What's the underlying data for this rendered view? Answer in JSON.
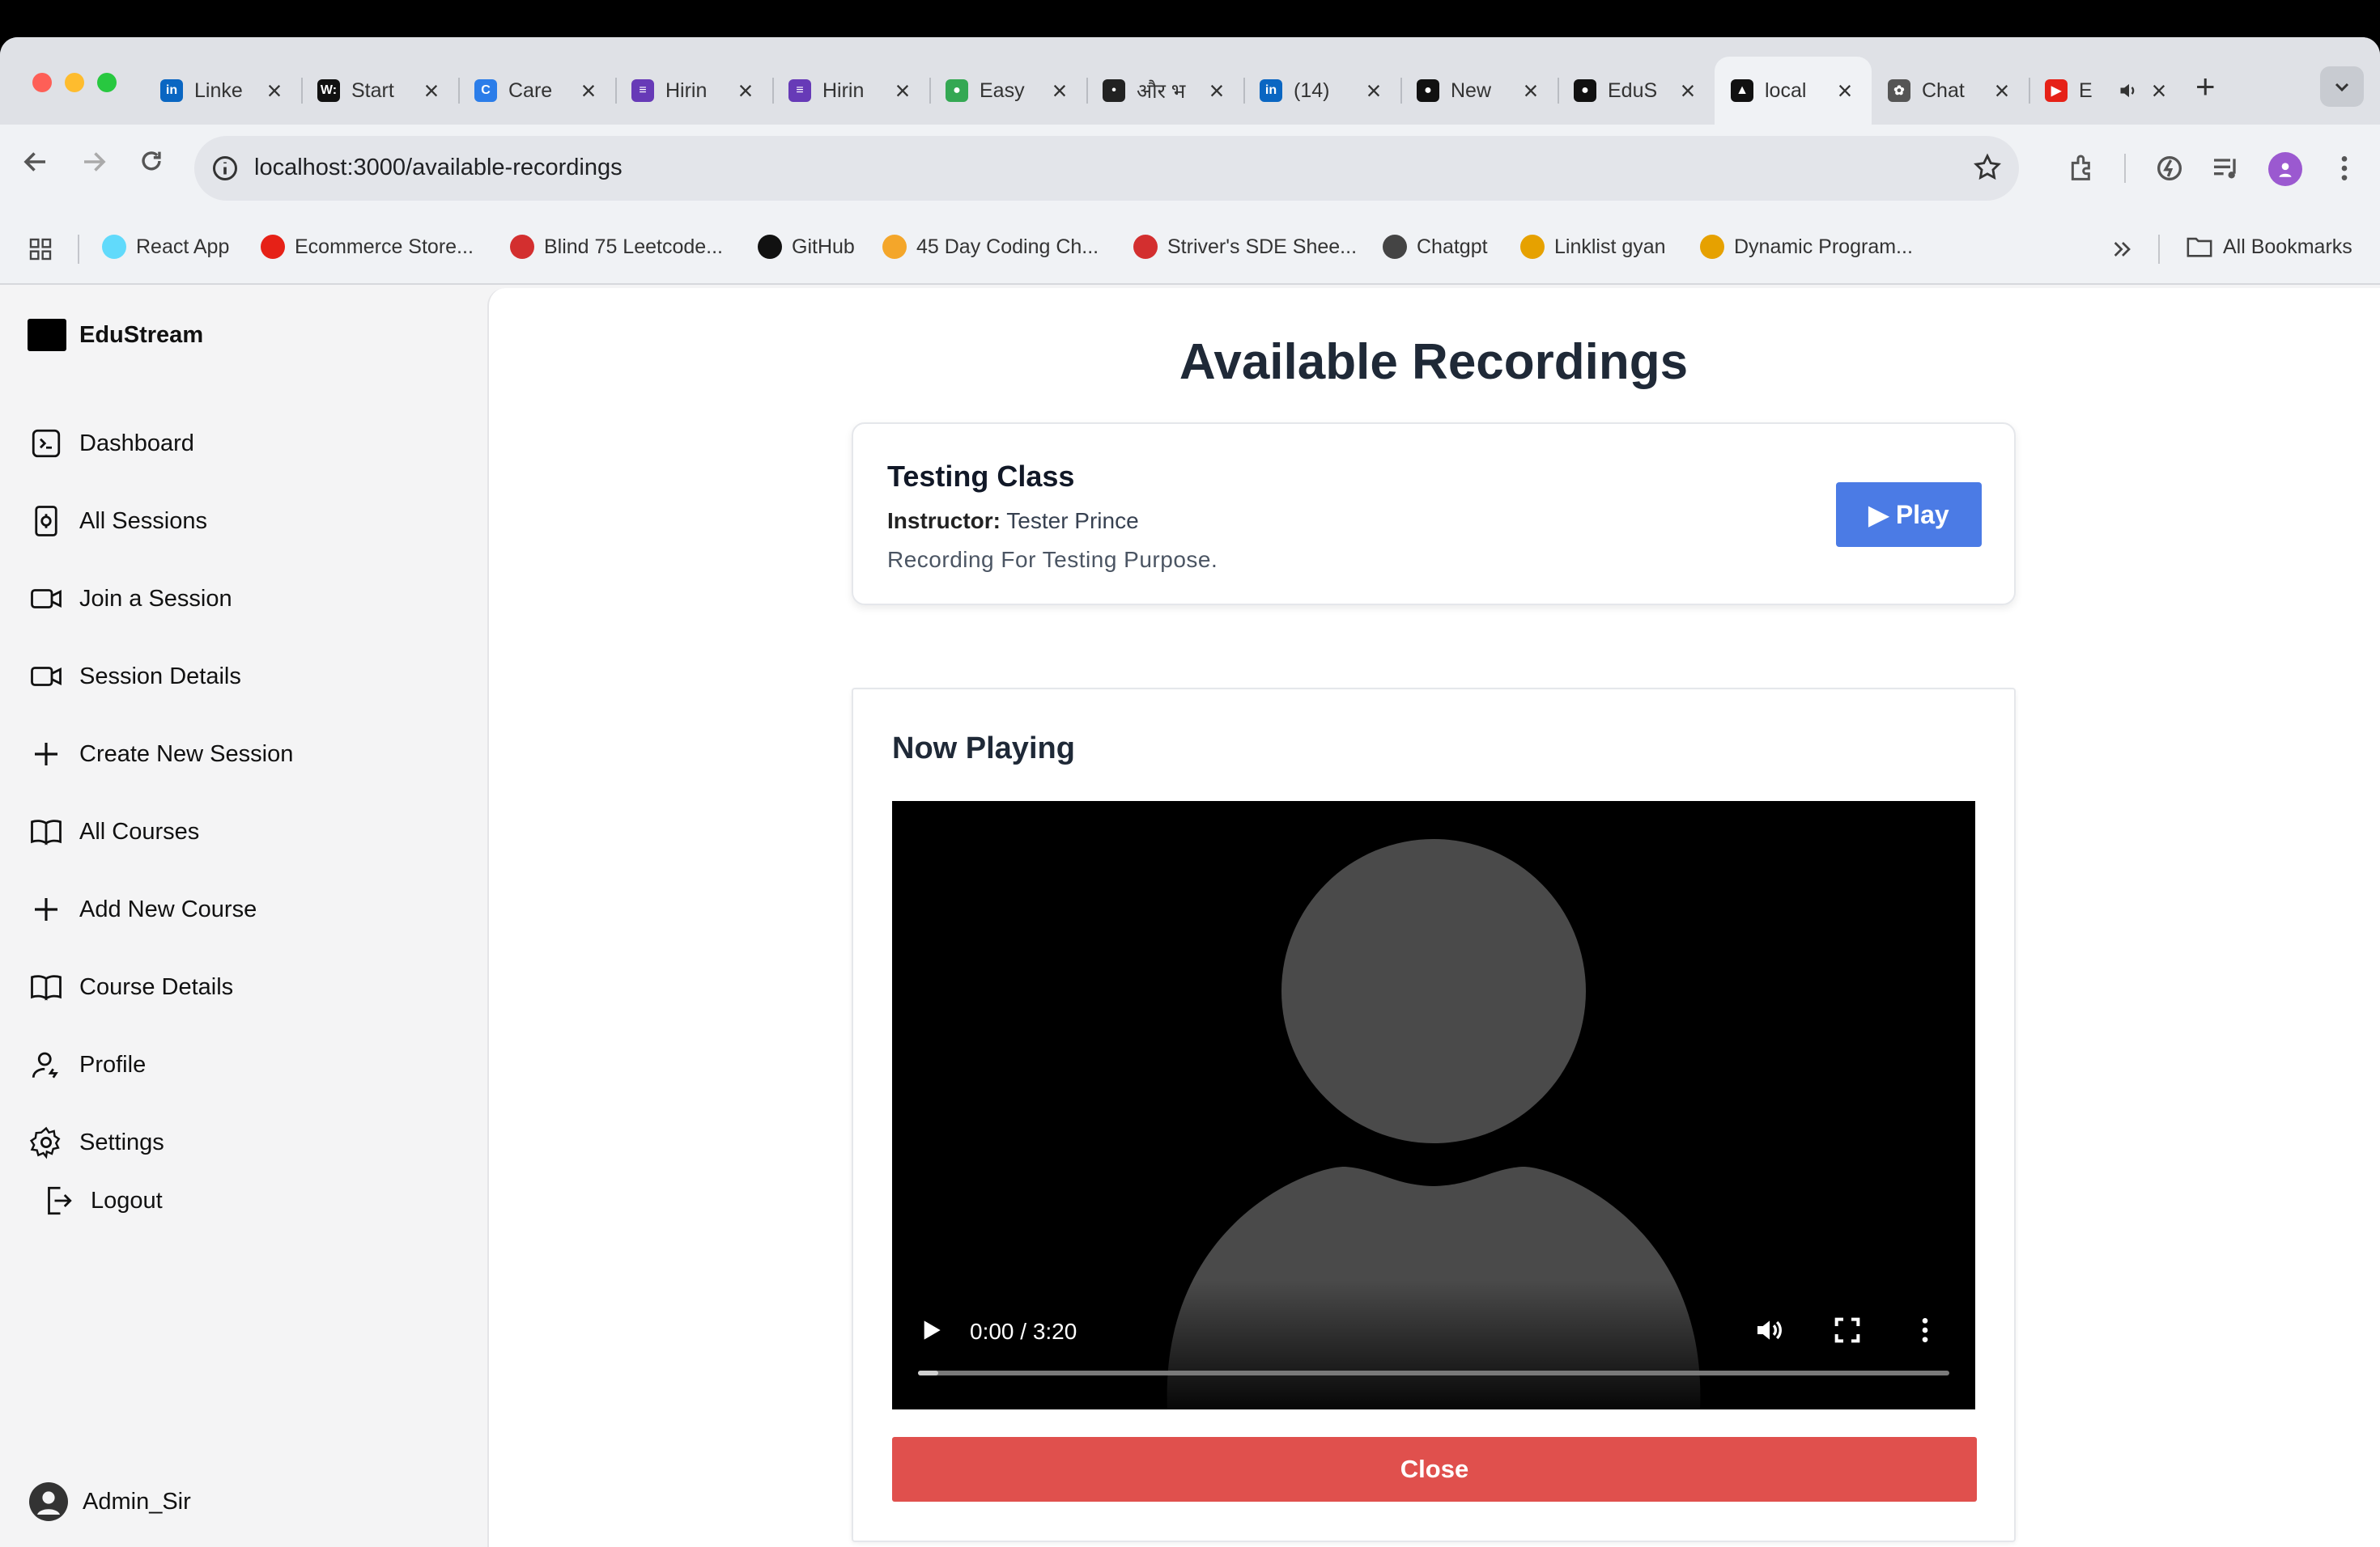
{
  "browser": {
    "tabs": [
      {
        "title": "Linke",
        "icon": "linkedin-icon",
        "color": "#0a66c2",
        "glyph": "in"
      },
      {
        "title": "Start",
        "icon": "wellfound-icon",
        "color": "#111111",
        "glyph": "W:"
      },
      {
        "title": "Care",
        "icon": "career-icon",
        "color": "#2b7de9",
        "glyph": "C"
      },
      {
        "title": "Hirin",
        "icon": "form-icon",
        "color": "#673ab7",
        "glyph": "≡"
      },
      {
        "title": "Hirin",
        "icon": "form-icon",
        "color": "#673ab7",
        "glyph": "≡"
      },
      {
        "title": "Easy",
        "icon": "easy-icon",
        "color": "#34a853",
        "glyph": "●"
      },
      {
        "title": "और भ",
        "icon": "hindi-site-icon",
        "color": "#222222",
        "glyph": "•"
      },
      {
        "title": "(14)",
        "icon": "linkedin-icon",
        "color": "#0a66c2",
        "glyph": "in"
      },
      {
        "title": "New",
        "icon": "github-icon",
        "color": "#111111",
        "glyph": "●"
      },
      {
        "title": "EduS",
        "icon": "github-icon",
        "color": "#111111",
        "glyph": "●"
      },
      {
        "title": "local",
        "icon": "nextjs-icon",
        "color": "#111111",
        "glyph": "▲",
        "active": true
      },
      {
        "title": "Chat",
        "icon": "chatgpt-icon",
        "color": "#555555",
        "glyph": "✿"
      },
      {
        "title": "E",
        "icon": "youtube-icon",
        "color": "#e62117",
        "glyph": "▶",
        "audio": true
      }
    ],
    "url": "localhost:3000/available-recordings",
    "bookmarks": [
      {
        "label": "React App",
        "icon": "react-icon",
        "color": "#61dafb"
      },
      {
        "label": "Ecommerce Store...",
        "icon": "youtube-icon",
        "color": "#e62117"
      },
      {
        "label": "Blind 75 Leetcode...",
        "icon": "tuf-icon",
        "color": "#d32f2f"
      },
      {
        "label": "GitHub",
        "icon": "github-icon",
        "color": "#111111"
      },
      {
        "label": "45 Day Coding Ch...",
        "icon": "coding-icon",
        "color": "#f4a62a"
      },
      {
        "label": "Striver's SDE Shee...",
        "icon": "tuf-icon",
        "color": "#d32f2f"
      },
      {
        "label": "Chatgpt",
        "icon": "chatgpt-icon",
        "color": "#444444"
      },
      {
        "label": "Linklist gyan",
        "icon": "linklist-icon",
        "color": "#e6a100"
      },
      {
        "label": "Dynamic Program...",
        "icon": "linklist-icon",
        "color": "#e6a100"
      }
    ],
    "all_bookmarks": "All Bookmarks"
  },
  "sidebar": {
    "brand": "EduStream",
    "items": [
      {
        "label": "Dashboard",
        "icon": "terminal-icon"
      },
      {
        "label": "All Sessions",
        "icon": "sessions-icon"
      },
      {
        "label": "Join a Session",
        "icon": "video-icon"
      },
      {
        "label": "Session Details",
        "icon": "video-icon"
      },
      {
        "label": "Create New Session",
        "icon": "plus-icon"
      },
      {
        "label": "All Courses",
        "icon": "book-icon"
      },
      {
        "label": "Add New Course",
        "icon": "plus-icon"
      },
      {
        "label": "Course Details",
        "icon": "book-icon"
      },
      {
        "label": "Profile",
        "icon": "user-icon"
      },
      {
        "label": "Settings",
        "icon": "gear-icon"
      }
    ],
    "logout": "Logout",
    "user": "Admin_Sir"
  },
  "main": {
    "title": "Available Recordings",
    "recording": {
      "title": "Testing Class",
      "instructor_label": "Instructor:",
      "instructor": "Tester Prince",
      "description": "Recording For Testing Purpose.",
      "play_label": "▶ Play"
    },
    "player": {
      "heading": "Now Playing",
      "time": "0:00 / 3:20",
      "progress": 0.02,
      "close_label": "Close"
    }
  },
  "colors": {
    "accent": "#4b7be5",
    "danger": "#e0504d"
  }
}
